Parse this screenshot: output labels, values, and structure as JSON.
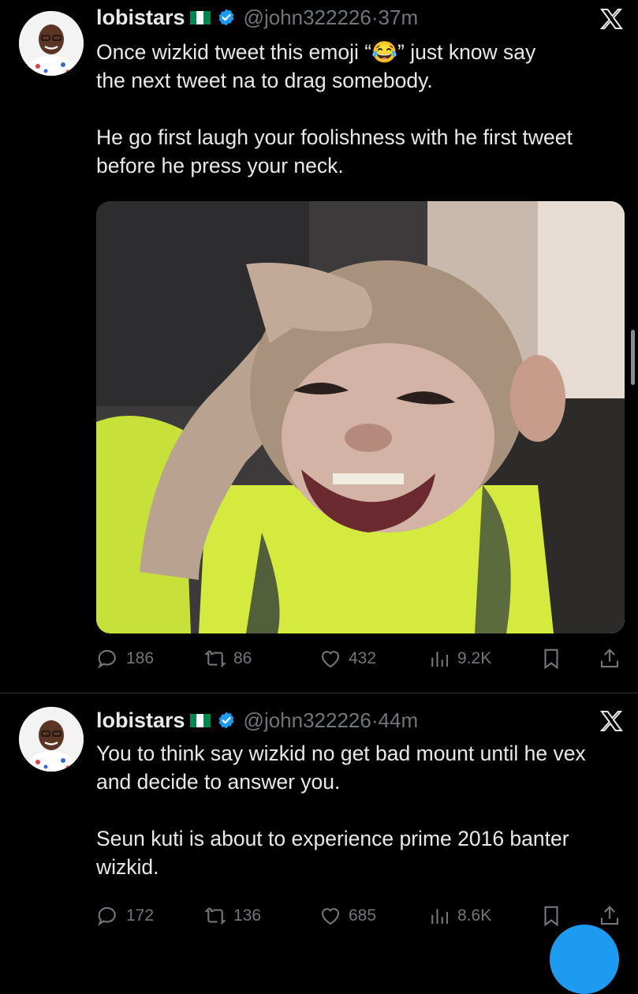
{
  "tweets": [
    {
      "author": {
        "name": "lobistars",
        "handle": "@john322226",
        "time": "37m"
      },
      "text_lines": [
        [
          "Once wizkid tweet this emoji “",
          "😂",
          "” just know say"
        ],
        "the next tweet na to drag somebody."
      ],
      "text_para2": "He go first laugh your foolishness with he first tweet before he press your neck.",
      "stats": {
        "replies": "186",
        "reposts": "86",
        "likes": "432",
        "views": "9.2K"
      }
    },
    {
      "author": {
        "name": "lobistars",
        "handle": "@john322226",
        "time": "44m"
      },
      "text_para1": "You to think say wizkid no get bad mount until he vex and decide to answer you.",
      "text_para2": "Seun kuti is about to experience prime 2016 banter wizkid.",
      "stats": {
        "replies": "172",
        "reposts": "136",
        "likes": "685",
        "views": "8.6K"
      }
    }
  ],
  "colors": {
    "background": "#000000",
    "text": "#e7e9ea",
    "muted": "#71767b",
    "accent": "#1d9bf0",
    "flag_green": "#008751"
  },
  "icons": [
    "avatar",
    "nigeria-flag-icon",
    "verified-badge-icon",
    "x-logo-icon",
    "reply-icon",
    "repost-icon",
    "like-icon",
    "views-icon",
    "bookmark-icon",
    "share-icon"
  ]
}
